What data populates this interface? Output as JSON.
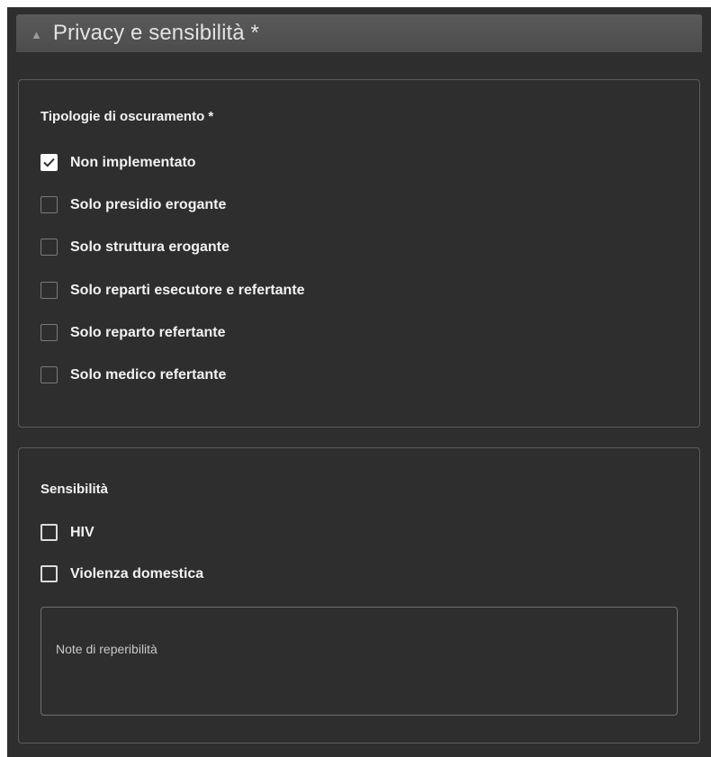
{
  "panel": {
    "title": "Privacy e sensibilità *",
    "collapse_icon": "triangle-up-icon"
  },
  "oscuramento": {
    "legend": "Tipologie di oscuramento *",
    "options": [
      {
        "label": "Non implementato",
        "checked": true
      },
      {
        "label": "Solo presidio erogante",
        "checked": false
      },
      {
        "label": "Solo struttura erogante",
        "checked": false
      },
      {
        "label": "Solo reparti esecutore e refertante",
        "checked": false
      },
      {
        "label": "Solo reparto refertante",
        "checked": false
      },
      {
        "label": "Solo medico refertante",
        "checked": false
      }
    ]
  },
  "sensibilita": {
    "legend": "Sensibilità",
    "options": [
      {
        "label": "HIV",
        "checked": false
      },
      {
        "label": "Violenza domestica",
        "checked": false
      }
    ],
    "notes": {
      "placeholder": "Note di reperibilità",
      "value": ""
    }
  },
  "colors": {
    "panel_bg": "#2e2e2e",
    "header_bg": "#525252",
    "border": "#5c5c5c",
    "text": "#f2f2f2"
  }
}
